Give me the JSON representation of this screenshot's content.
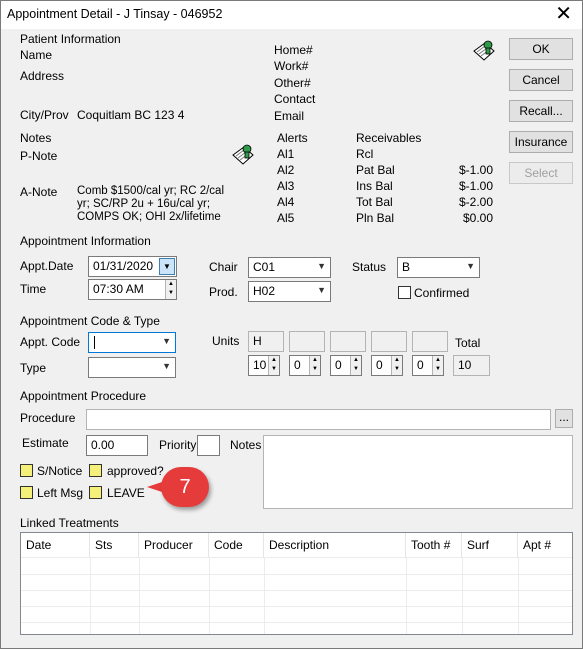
{
  "window": {
    "title": "Appointment Detail - J Tinsay - 046952",
    "close_glyph": "✕"
  },
  "buttons": {
    "ok": "OK",
    "cancel": "Cancel",
    "recall": "Recall...",
    "insurance": "Insurance",
    "select": "Select"
  },
  "patient": {
    "section_label": "Patient Information",
    "name_label": "Name",
    "address_label": "Address",
    "city_label": "City/Prov",
    "city_value": "Coquitlam BC 123   4",
    "notes_label": "Notes",
    "pnote_label": "P-Note",
    "anote_label": "A-Note",
    "anote_value": [
      "Comb $1500/cal yr; RC 2/cal",
      "yr; SC/RP 2u + 16u/cal yr;",
      "COMPS OK; OHI 2x/lifetime"
    ],
    "phone_labels": [
      "Home#",
      "Work#",
      "Other#",
      "Contact",
      "Email"
    ]
  },
  "alerts": {
    "label": "Alerts",
    "items": [
      "Al1",
      "Al2",
      "Al3",
      "Al4",
      "Al5"
    ]
  },
  "receivables": {
    "label": "Receivables",
    "rows": [
      {
        "label": "Rcl",
        "value": ""
      },
      {
        "label": "Pat Bal",
        "value": "$-1.00"
      },
      {
        "label": "Ins Bal",
        "value": "$-1.00"
      },
      {
        "label": "Tot Bal",
        "value": "$-2.00"
      },
      {
        "label": "Pln Bal",
        "value": "$0.00"
      }
    ]
  },
  "appointment": {
    "section_label": "Appointment Information",
    "date_label": "Appt.Date",
    "date_value": "01/31/2020",
    "time_label": "Time",
    "time_value": "07:30 AM",
    "chair_label": "Chair",
    "chair_value": "C01",
    "prod_label": "Prod.",
    "prod_value": "H02",
    "status_label": "Status",
    "status_value": "B",
    "confirmed_label": "Confirmed"
  },
  "code_type": {
    "section_label": "Appointment Code & Type",
    "code_label": "Appt. Code",
    "code_value": "",
    "type_label": "Type",
    "type_value": "",
    "units_label": "Units",
    "units_codes": [
      "H",
      "",
      "",
      "",
      ""
    ],
    "units_values": [
      "10",
      "0",
      "0",
      "0",
      "0"
    ],
    "total_label": "Total",
    "total_value": "10"
  },
  "procedure": {
    "section_label": "Appointment Procedure",
    "procedure_label": "Procedure",
    "procedure_value": "",
    "browse_label": "...",
    "estimate_label": "Estimate",
    "estimate_value": "0.00",
    "priority_label": "Priority",
    "priority_value": "",
    "notes_label": "Notes",
    "notes_value": "",
    "flags": [
      "S/Notice",
      "approved?",
      "Left Msg",
      "LEAVE"
    ]
  },
  "callout": {
    "number": "7",
    "color": "#e63b3b"
  },
  "linked": {
    "section_label": "Linked Treatments",
    "columns": [
      "Date",
      "Sts",
      "Producer",
      "Code",
      "Description",
      "Tooth #",
      "Surf",
      "Apt #"
    ]
  },
  "icons": {
    "note_pad": "note-pad-icon",
    "dropdown": "chevron-down-icon",
    "calendar": "calendar-dropdown-icon"
  }
}
